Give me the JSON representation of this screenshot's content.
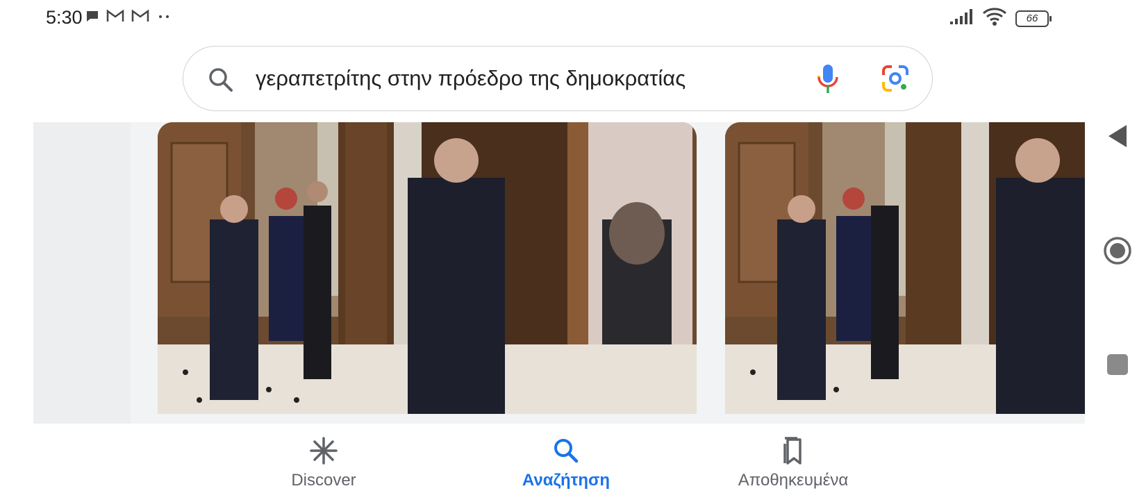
{
  "status": {
    "time": "5:30",
    "battery": "66",
    "left_icons": [
      "chat-icon",
      "gmail-icon",
      "gmail-icon",
      "more-dots-icon"
    ],
    "right_icons": [
      "signal-icon",
      "wifi-icon",
      "battery-icon"
    ]
  },
  "search": {
    "query": "γεραπετρίτης στην πρόεδρο της δημοκρατίας",
    "icons": [
      "search-icon",
      "mic-icon",
      "google-lens-icon"
    ]
  },
  "results": {
    "images": [
      {
        "name": "result-image-1"
      },
      {
        "name": "result-image-2"
      }
    ]
  },
  "system_nav": [
    "back-icon",
    "home-icon",
    "recents-icon"
  ],
  "bottom_nav": {
    "tabs": [
      {
        "label": "Discover",
        "icon": "asterisk-icon",
        "active": false
      },
      {
        "label": "Αναζήτηση",
        "icon": "search-icon",
        "active": true
      },
      {
        "label": "Αποθηκευμένα",
        "icon": "bookmarks-icon",
        "active": false
      }
    ]
  },
  "colors": {
    "accent": "#1a73e8",
    "text": "#202124",
    "muted": "#5f6368"
  }
}
